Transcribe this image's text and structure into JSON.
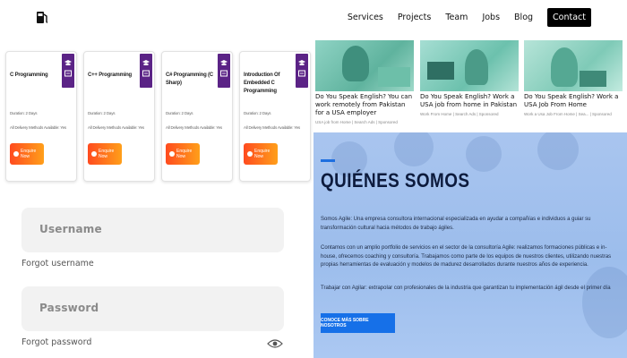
{
  "nav": {
    "logo_icon": "fuel-pump-icon",
    "items": [
      "Services",
      "Projects",
      "Team",
      "Jobs",
      "Blog"
    ],
    "contact": "Contact"
  },
  "courses": [
    {
      "title": "C Programming",
      "duration": "Duration: 2 Days",
      "delivery": "All Delivery Methods Available: Yes",
      "button": "Enquire Now"
    },
    {
      "title": "C++ Programming",
      "duration": "Duration: 2 Days",
      "delivery": "All Delivery Methods Available: Yes",
      "button": "Enquire Now"
    },
    {
      "title": "C# Programming (C Sharp)",
      "duration": "Duration: 2 Days",
      "delivery": "All Delivery Methods Available: Yes",
      "button": "Enquire Now"
    },
    {
      "title": "Introduction Of Embedded C Programming",
      "duration": "Duration: 2 Days",
      "delivery": "All Delivery Methods Available: Yes",
      "button": "Enquire Now"
    }
  ],
  "login": {
    "username_placeholder": "Username",
    "forgot_username": "Forgot username",
    "password_placeholder": "Password",
    "forgot_password": "Forgot password",
    "eye_icon": "eye-icon"
  },
  "articles": [
    {
      "title": "Do You Speak English? You can work remotely from Pakistan for a USA employer",
      "source": "USA job from Home | Search Ads | Sponsored"
    },
    {
      "title": "Do You Speak English? Work a USA job from home in Pakistan",
      "source": "Work From Home | Search Ads | Sponsored"
    },
    {
      "title": "Do You Speak English? Work a USA Job From Home",
      "source": "Work a Usa Job From Home | Sea... | Sponsored"
    }
  ],
  "about": {
    "heading": "QUIÉNES SOMOS",
    "p1": "Somos Agile: Una empresa consultora internacional especializada en ayudar a compañías e individuos a guiar su transformación cultural hacia métodos de trabajo ágiles.",
    "p2": "Contamos con un amplio portfolio de servicios en el sector de la consultoría Agile: realizamos formaciones públicas e in-house, ofrecemos coaching y consultoría. Trabajamos como parte de los equipos de nuestros clientes, utilizando nuestras propias herramientas de evaluación y modelos de madurez desarrollados durante nuestros años de experiencia.",
    "p3": "Trabajar con Agilar: extrapolar con profesionales de la industria que garantizan tu implementación ágil desde el primer día",
    "cta": "CONOCE MÁS SOBRE NOSOTROS"
  }
}
